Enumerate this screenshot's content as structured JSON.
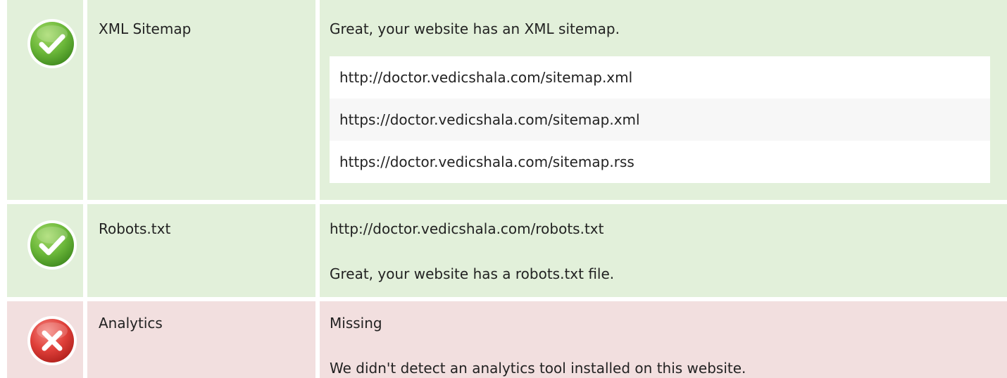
{
  "rows": [
    {
      "status": "pass",
      "icon": "check-circle-icon",
      "label": "XML Sitemap",
      "message": "Great, your website has an XML sitemap.",
      "urls": [
        "http://doctor.vedicshala.com/sitemap.xml",
        "https://doctor.vedicshala.com/sitemap.xml",
        "https://doctor.vedicshala.com/sitemap.rss"
      ]
    },
    {
      "status": "pass",
      "icon": "check-circle-icon",
      "label": "Robots.txt",
      "url": "http://doctor.vedicshala.com/robots.txt",
      "message": "Great, your website has a robots.txt file."
    },
    {
      "status": "fail",
      "icon": "error-circle-icon",
      "label": "Analytics",
      "value": "Missing",
      "message": "We didn't detect an analytics tool installed on this website."
    }
  ],
  "colors": {
    "pass_background": "#e2f0da",
    "fail_background": "#f2dfdf",
    "pass_icon": "#5aa82c",
    "fail_icon": "#d8302a"
  }
}
